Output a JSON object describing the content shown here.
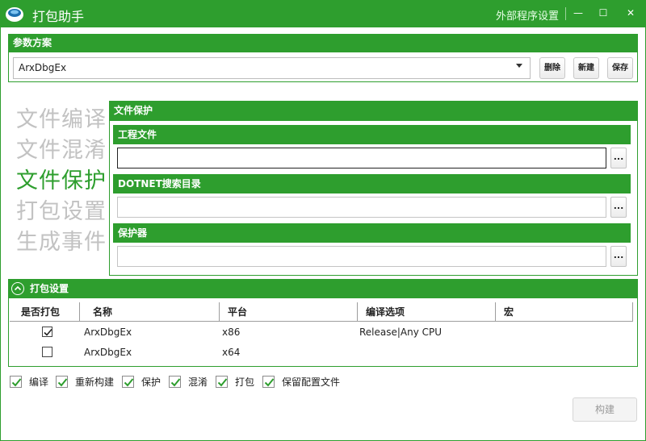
{
  "window": {
    "title": "打包助手",
    "external_settings": "外部程序设置",
    "min_glyph": "—",
    "max_glyph": "☐",
    "close_glyph": "✕"
  },
  "param_scheme": {
    "header": "参数方案",
    "selected": "ArxDbgEx",
    "delete_label": "删除",
    "new_label": "新建",
    "save_label": "保存"
  },
  "nav": {
    "items": [
      "文件编译",
      "文件混淆",
      "文件保护",
      "打包设置",
      "生成事件"
    ],
    "active_index": 2
  },
  "file_protection": {
    "header": "文件保护",
    "sections": [
      {
        "label": "工程文件",
        "value": "",
        "button": "..."
      },
      {
        "label": "DOTNET搜索目录",
        "value": "",
        "button": "..."
      },
      {
        "label": "保护器",
        "value": "",
        "button": "..."
      }
    ]
  },
  "pack_settings": {
    "header": "打包设置",
    "columns": [
      "是否打包",
      "名称",
      "平台",
      "编译选项",
      "宏"
    ],
    "rows": [
      {
        "checked": true,
        "name": "ArxDbgEx",
        "platform": "x86",
        "compile": "Release|Any CPU",
        "macro": ""
      },
      {
        "checked": false,
        "name": "ArxDbgEx",
        "platform": "x64",
        "compile": "",
        "macro": ""
      }
    ]
  },
  "options": [
    {
      "label": "编译",
      "checked": true
    },
    {
      "label": "重新构建",
      "checked": true
    },
    {
      "label": "保护",
      "checked": true
    },
    {
      "label": "混淆",
      "checked": true
    },
    {
      "label": "打包",
      "checked": true
    },
    {
      "label": "保留配置文件",
      "checked": true
    }
  ],
  "build_button": "构建",
  "colors": {
    "accent": "#2e9e2e",
    "nav_inactive": "#c2c2c2"
  }
}
